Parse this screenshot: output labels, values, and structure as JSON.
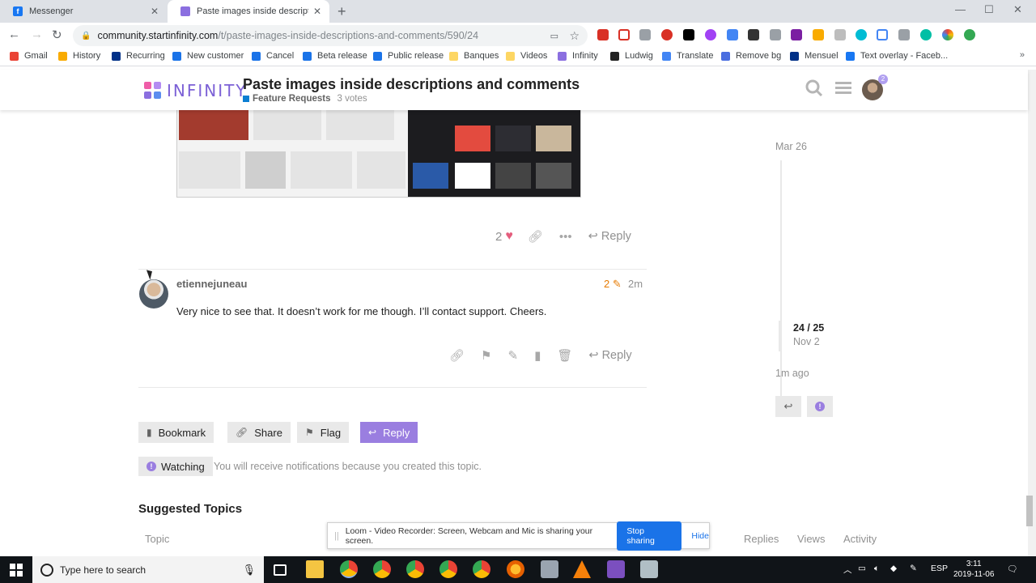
{
  "browser": {
    "tabs": [
      {
        "title": "Messenger",
        "icon": "facebook-icon",
        "active": false
      },
      {
        "title": "Paste images inside descriptions",
        "icon": "infinity-icon",
        "active": true
      }
    ],
    "url_host": "community.startinfinity.com",
    "url_path": "/t/paste-images-inside-descriptions-and-comments/590/24",
    "bookmarks": [
      "Gmail",
      "History",
      "Recurring",
      "New customer",
      "Cancel",
      "Beta release",
      "Public release",
      "Banques",
      "Videos",
      "Infinity",
      "Ludwig",
      "Translate",
      "Remove bg",
      "Mensuel",
      "Text overlay - Faceb..."
    ],
    "bookmarks_more": "»"
  },
  "header": {
    "logo": "INFINITY",
    "title": "Paste images inside descriptions and comments",
    "category": "Feature Requests",
    "votes": "3 votes",
    "notification_count": "2"
  },
  "previous_post": {
    "likes": "2",
    "reply_label": "Reply"
  },
  "post": {
    "username": "etiennejuneau",
    "edit_count": "2",
    "time": "2m",
    "body": "Very nice to see that. It doesn’t work for me though. I’ll contact support. Cheers.",
    "reply_label": "Reply"
  },
  "footer_buttons": {
    "bookmark": "Bookmark",
    "share": "Share",
    "flag": "Flag",
    "reply": "Reply"
  },
  "notifications": {
    "level": "Watching",
    "description": "You will receive notifications because you created this topic."
  },
  "suggested": {
    "heading": "Suggested Topics",
    "columns": [
      "Topic",
      "Replies",
      "Views",
      "Activity"
    ]
  },
  "timeline": {
    "start_date": "Mar 26",
    "position": "24 / 25",
    "position_date": "Nov 2",
    "end_label": "1m ago"
  },
  "loom": {
    "message": "Loom - Video Recorder: Screen, Webcam and Mic is sharing your screen.",
    "stop": "Stop sharing",
    "hide": "Hide"
  },
  "taskbar": {
    "search_placeholder": "Type here to search",
    "lang": "ESP",
    "time": "3:11",
    "date": "2019-11-06"
  },
  "colors": {
    "accent": "#9a7ee0",
    "category": "#0b7ed2",
    "heart": "#e45e7e",
    "edit": "#e67a00"
  }
}
